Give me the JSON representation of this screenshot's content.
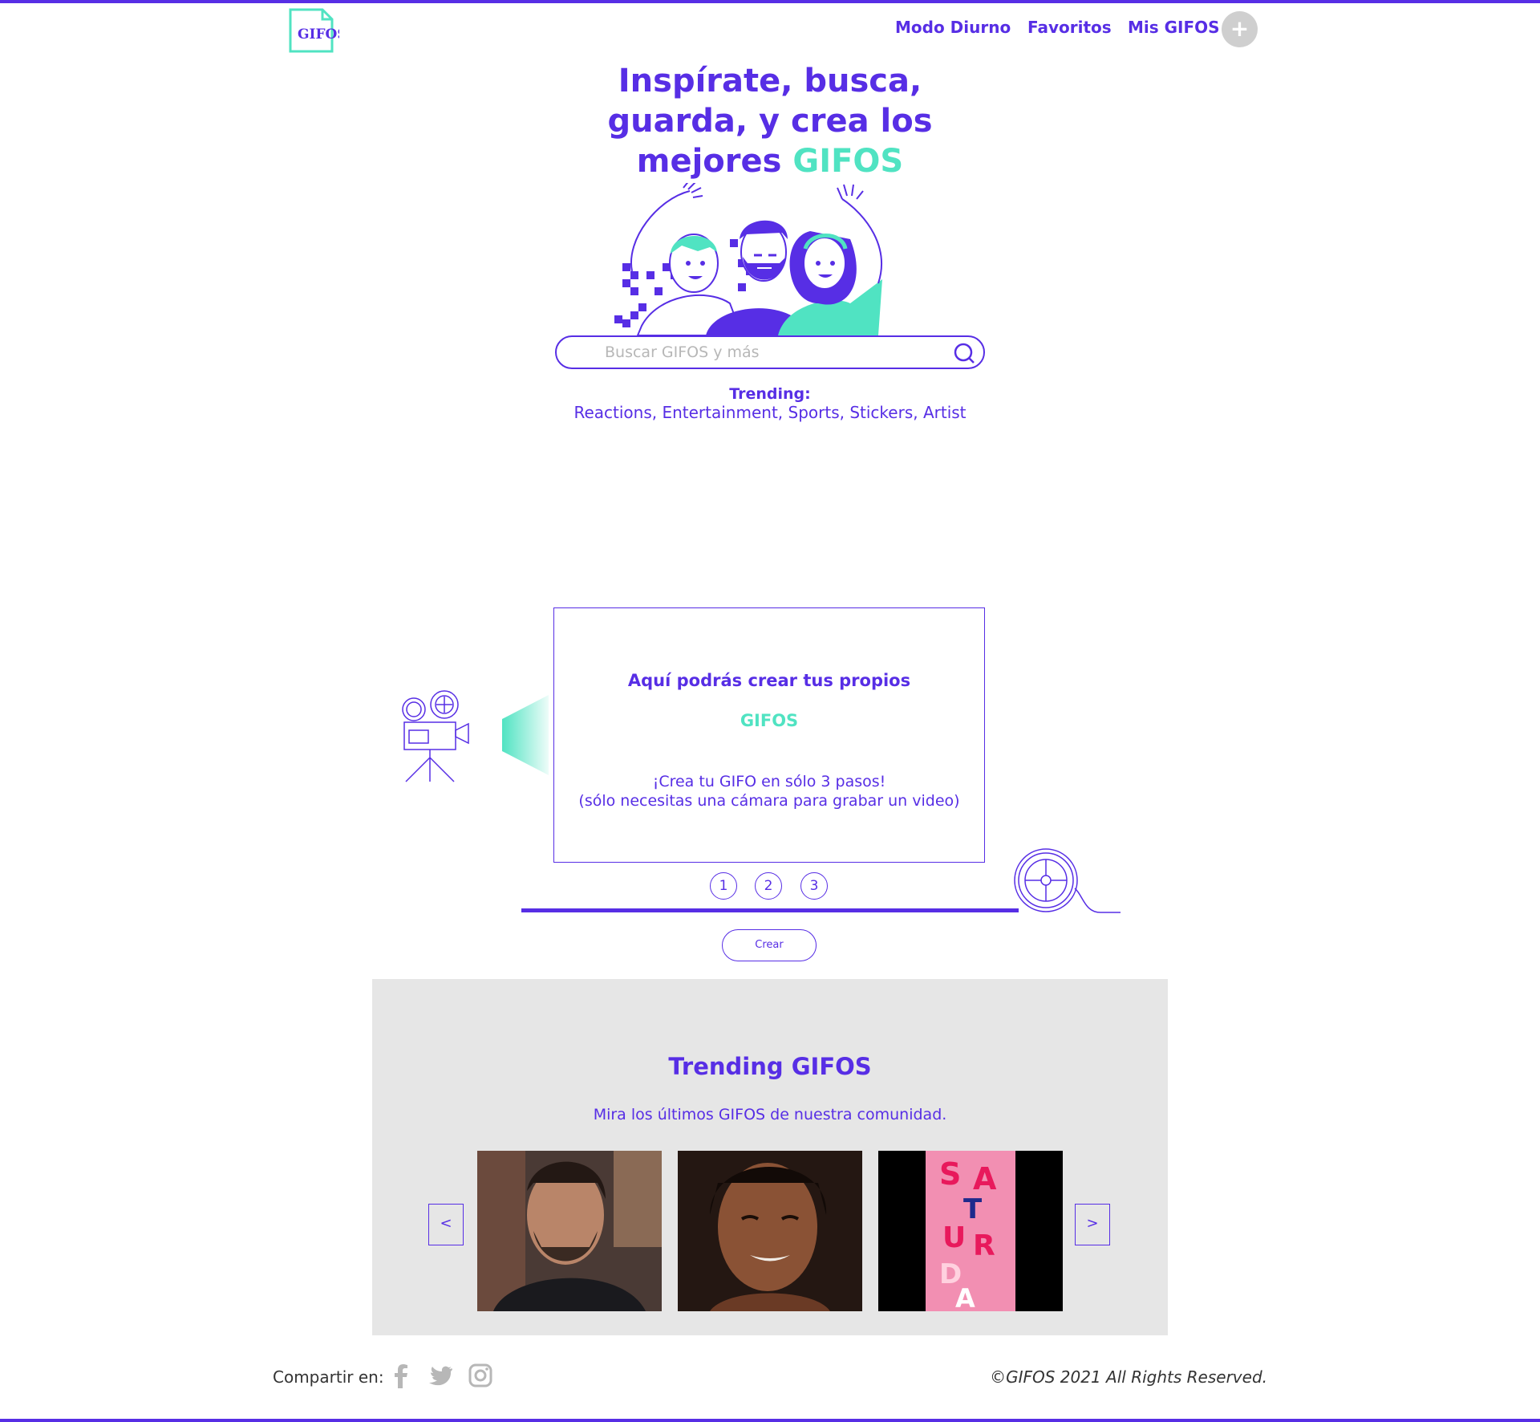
{
  "header": {
    "logo_text": "GIFOS",
    "nav": [
      "Modo Diurno",
      "Favoritos",
      "Mis GIFOS"
    ],
    "add_button": "+"
  },
  "hero": {
    "title_line1": "Inspírate, busca,",
    "title_line2": "guarda, y crea los",
    "title_line3_a": "mejores ",
    "title_line3_b": "GIFOS"
  },
  "search": {
    "placeholder": "Buscar GIFOS y más",
    "value": ""
  },
  "trending_terms": {
    "label": "Trending:",
    "terms": "Reactions, Entertainment, Sports, Stickers, Artist"
  },
  "create": {
    "title": "Aquí podrás crear tus propios",
    "title_accent": "GIFOS",
    "line1": "¡Crea tu GIFO en sólo 3 pasos!",
    "line2": "(sólo necesitas una cámara para grabar un video)",
    "steps": [
      "1",
      "2",
      "3"
    ],
    "button": "Crear"
  },
  "trending_gifos": {
    "title": "Trending GIFOS",
    "subtitle": "Mira los últimos GIFOS de nuestra comunidad.",
    "prev": "<",
    "next": ">",
    "third_gif_text": [
      "S",
      "A",
      "T",
      "U",
      "R",
      "D",
      "A"
    ]
  },
  "footer": {
    "share_label": "Compartir en:",
    "icons": [
      "facebook-icon",
      "twitter-icon",
      "instagram-icon"
    ],
    "copyright": "©GIFOS 2021 All Rights Reserved."
  },
  "colors": {
    "primary": "#572EE5",
    "accent": "#50E3C2",
    "section_bg": "#e6e6e6"
  }
}
